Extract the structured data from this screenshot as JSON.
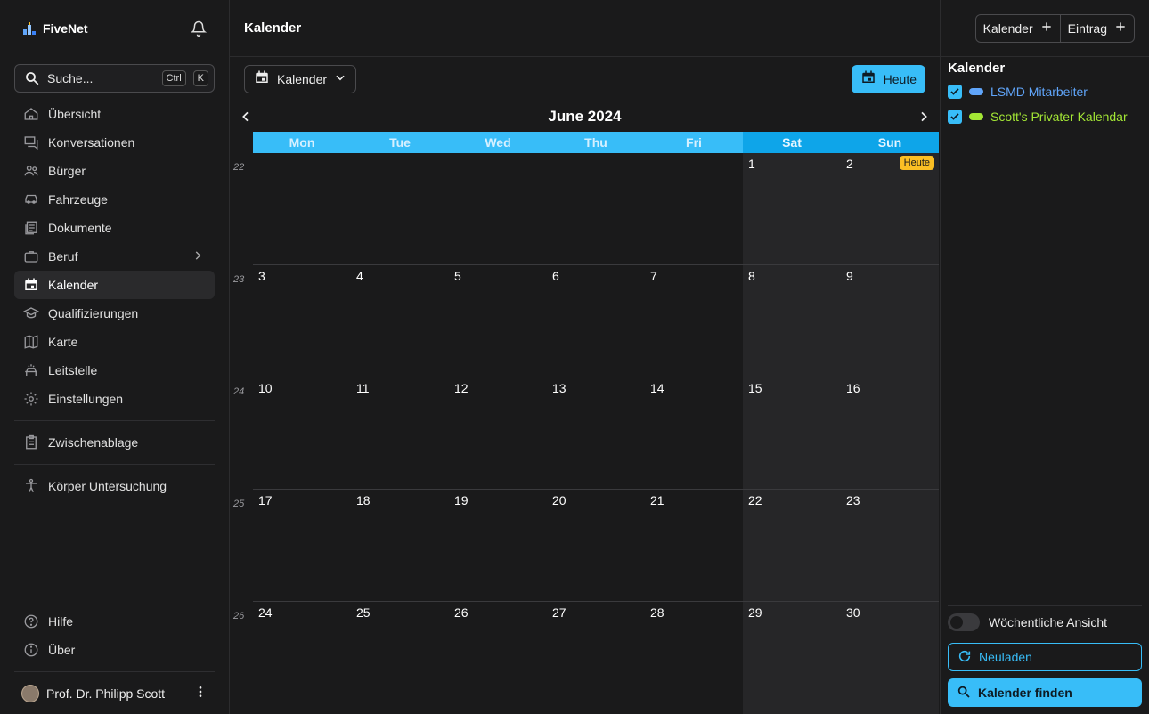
{
  "sidebar": {
    "brand": "FiveNet",
    "search": {
      "placeholder": "Suche...",
      "kbd1": "Ctrl",
      "kbd2": "K"
    },
    "items": [
      {
        "label": "Übersicht",
        "icon": "home-icon"
      },
      {
        "label": "Konversationen",
        "icon": "chat-icon"
      },
      {
        "label": "Bürger",
        "icon": "users-icon"
      },
      {
        "label": "Fahrzeuge",
        "icon": "car-icon"
      },
      {
        "label": "Dokumente",
        "icon": "documents-icon"
      },
      {
        "label": "Beruf",
        "icon": "briefcase-icon"
      },
      {
        "label": "Kalender",
        "icon": "calendar-icon"
      },
      {
        "label": "Qualifizierungen",
        "icon": "school-icon"
      },
      {
        "label": "Karte",
        "icon": "map-icon"
      },
      {
        "label": "Leitstelle",
        "icon": "dispatch-icon"
      },
      {
        "label": "Einstellungen",
        "icon": "gear-icon"
      }
    ],
    "clipboard": "Zwischenablage",
    "body_exam": "Körper Untersuchung",
    "help": "Hilfe",
    "about": "Über",
    "user": "Prof. Dr. Philipp Scott"
  },
  "main": {
    "title": "Kalender",
    "view_select": "Kalender",
    "today_button": "Heute",
    "month": "June 2024",
    "weekdays": [
      "Mon",
      "Tue",
      "Wed",
      "Thu",
      "Fri",
      "Sat",
      "Sun"
    ],
    "weeks": [
      {
        "num": "22",
        "days": [
          "",
          "",
          "",
          "",
          "",
          "1",
          "2"
        ]
      },
      {
        "num": "23",
        "days": [
          "3",
          "4",
          "5",
          "6",
          "7",
          "8",
          "9"
        ]
      },
      {
        "num": "24",
        "days": [
          "10",
          "11",
          "12",
          "13",
          "14",
          "15",
          "16"
        ]
      },
      {
        "num": "25",
        "days": [
          "17",
          "18",
          "19",
          "20",
          "21",
          "22",
          "23"
        ]
      },
      {
        "num": "26",
        "days": [
          "24",
          "25",
          "26",
          "27",
          "28",
          "29",
          "30"
        ]
      }
    ],
    "today_badge": "Heute"
  },
  "right": {
    "add_calendar": "Kalender",
    "add_entry": "Eintrag",
    "heading": "Kalender",
    "calendars": [
      {
        "name": "LSMD Mitarbeiter",
        "color": "#60a5fa"
      },
      {
        "name": "Scott's Privater Kalendar",
        "color": "#a3e635"
      }
    ],
    "weekly_view": "Wöchentliche Ansicht",
    "reload": "Neuladen",
    "find_calendars": "Kalender finden"
  },
  "colors": {
    "accent": "#38bdf8",
    "today_badge": "#fbbf24"
  }
}
